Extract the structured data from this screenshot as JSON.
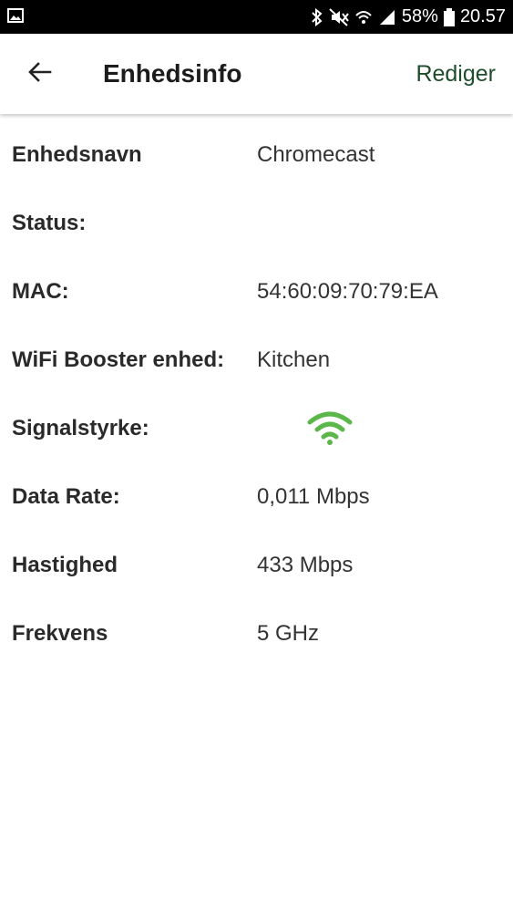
{
  "status_bar": {
    "battery": "58%",
    "time": "20.57",
    "icons": [
      "image-icon",
      "bluetooth-icon",
      "mute-icon",
      "wifi-icon",
      "cell-signal-icon",
      "battery-icon"
    ]
  },
  "header": {
    "title": "Enhedsinfo",
    "edit_label": "Rediger",
    "back_icon": "arrow-left-icon"
  },
  "device_info": {
    "rows": [
      {
        "label": "Enhedsnavn",
        "value": "Chromecast"
      },
      {
        "label": "Status:",
        "value": ""
      },
      {
        "label": "MAC:",
        "value": "54:60:09:70:79:EA"
      },
      {
        "label": "WiFi Booster enhed:",
        "value": "Kitchen"
      },
      {
        "label": "Signalstyrke:",
        "value": "",
        "icon": "wifi-signal-icon",
        "icon_color": "#5cb74a"
      },
      {
        "label": "Data Rate:",
        "value": "0,011 Mbps"
      },
      {
        "label": "Hastighed",
        "value": "433 Mbps"
      },
      {
        "label": "Frekvens",
        "value": "5 GHz"
      }
    ]
  },
  "colors": {
    "accent": "#1e4d2b",
    "signal": "#5cb74a",
    "status_bar_bg": "#000000"
  }
}
